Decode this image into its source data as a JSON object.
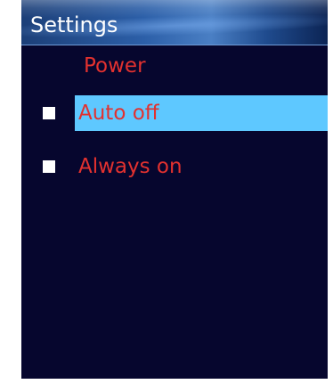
{
  "header": {
    "title": "Settings"
  },
  "section": {
    "title": "Power"
  },
  "menu": {
    "items": [
      {
        "label": "Auto off",
        "selected": true
      },
      {
        "label": "Always on",
        "selected": false
      }
    ]
  },
  "colors": {
    "background": "#06062e",
    "text_red": "#e2312f",
    "highlight": "#5ec8ff",
    "title_bar": "#2c5fa8",
    "bullet": "#ffffff"
  }
}
